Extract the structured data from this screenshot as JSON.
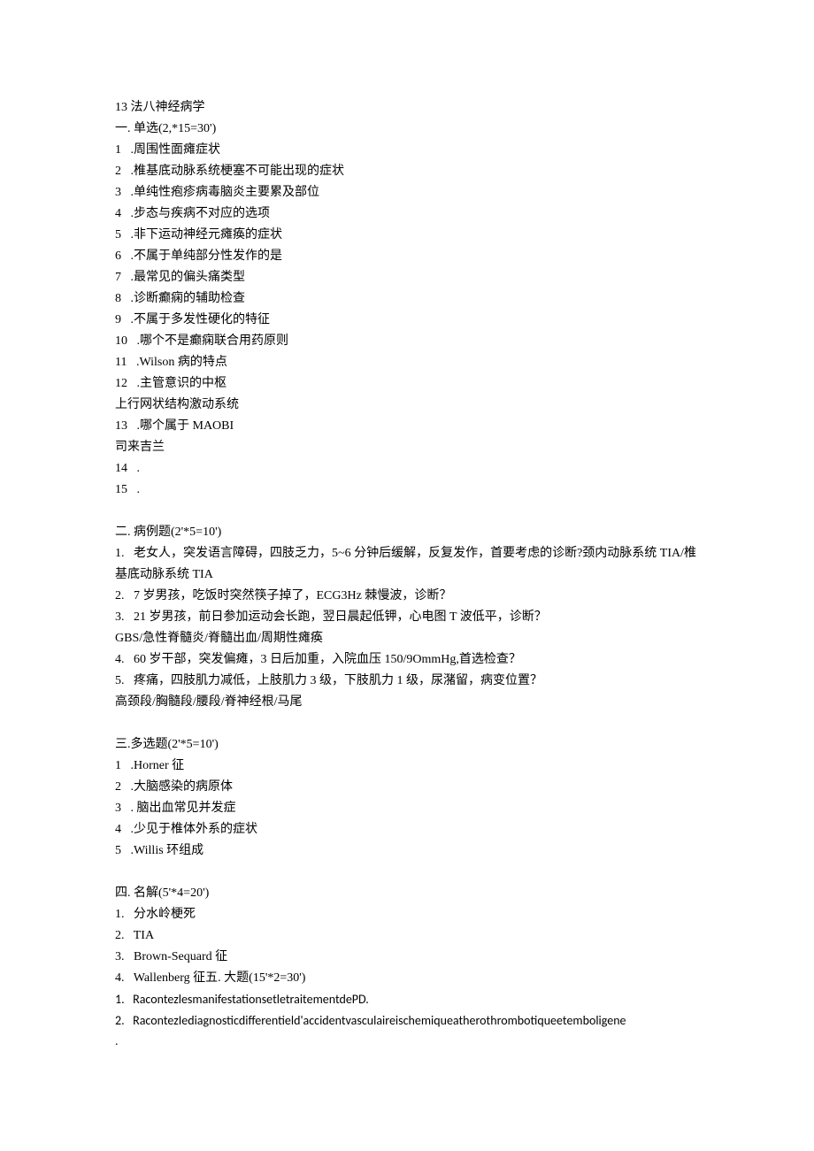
{
  "title": "13 法八神经病学",
  "section1": {
    "header": "一. 单选(2,*15=30')",
    "items": [
      "1   .周围性面瘫症状",
      "2   .椎基底动脉系统梗塞不可能出现的症状",
      "3   .单纯性疱疹病毒脑炎主要累及部位",
      "4   .步态与疾病不对应的选项",
      "5   .非下运动神经元瘫痪的症状",
      "6   .不属于单纯部分性发作的是",
      "7   .最常见的偏头痛类型",
      "8   .诊断癫痫的辅助检查",
      "9   .不属于多发性硬化的特征",
      "10   .哪个不是癫痫联合用药原则",
      "11   .Wilson 病的特点",
      "12   .主管意识的中枢",
      "上行网状结构激动系统",
      "13   .哪个属于 MAOBI",
      "司来吉兰",
      "14   .",
      "15   ."
    ]
  },
  "section2": {
    "header": "二. 病例题(2'*5=10')",
    "items": [
      "1.   老女人，突发语言障碍，四肢乏力，5~6 分钟后缓解，反复发作，首要考虑的诊断?颈内动脉系统 TIA/椎基底动脉系统 TIA",
      "2.   7 岁男孩，吃饭时突然筷子掉了，ECG3Hz 棘慢波，诊断？",
      "3.   21 岁男孩，前日参加运动会长跑，翌日晨起低钾，心电图 T 波低平，诊断？",
      "GBS/急性脊髓炎/脊髓出血/周期性瘫痪",
      "4.   60 岁干部，突发偏瘫，3 日后加重，入院血压 150/9OmmHg,首选检查？",
      "5.   疼痛，四肢肌力减低，上肢肌力 3 级，下肢肌力 1 级，尿潴留，病变位置？",
      "高颈段/胸髓段/腰段/脊神经根/马尾"
    ]
  },
  "section3": {
    "header": "三.多选题(2'*5=10')",
    "items": [
      "1   .Horner 征",
      "2   .大脑感染的病原体",
      "3   . 脑出血常见并发症",
      "4   .少见于椎体外系的症状",
      "5   .Willis 环组成"
    ]
  },
  "section4": {
    "header": "四. 名解(5'*4=20')",
    "items": [
      "1.   分水岭梗死",
      "2.   TIA",
      "3.   Brown-Sequard 征",
      "4.   Wallenberg 征五. 大题(15'*2=30')",
      "1.   RacontezlesmanifestationsetletraitementdePD.",
      "2.   RacontezIediagnosticdifferentield'accidentvasculaireischemiqueatherothrombotiqueetemboligene",
      "."
    ]
  }
}
